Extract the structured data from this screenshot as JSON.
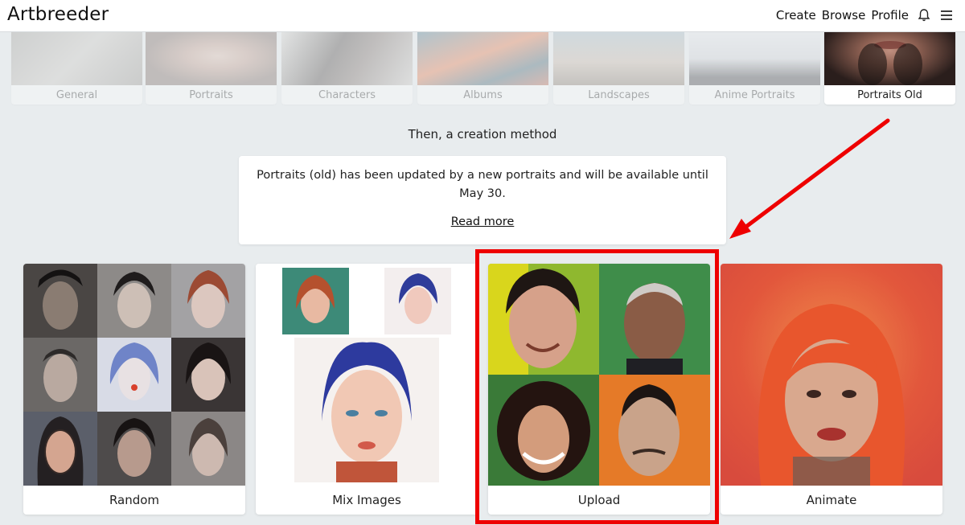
{
  "header": {
    "logo": "Artbreeder",
    "nav": [
      "Create",
      "Browse",
      "Profile"
    ],
    "icons": [
      "bell-icon",
      "menu-icon"
    ]
  },
  "categories": [
    {
      "label": "General",
      "selected": false
    },
    {
      "label": "Portraits",
      "selected": false
    },
    {
      "label": "Characters",
      "selected": false
    },
    {
      "label": "Albums",
      "selected": false
    },
    {
      "label": "Landscapes",
      "selected": false
    },
    {
      "label": "Anime Portraits",
      "selected": false
    },
    {
      "label": "Portraits Old",
      "selected": true
    }
  ],
  "subtitle": "Then, a creation method",
  "notice": {
    "text": "Portraits (old) has been updated by a new portraits and will be available until May 30.",
    "link": "Read more"
  },
  "methods": [
    "Random",
    "Mix Images",
    "Upload",
    "Animate"
  ],
  "colors": {
    "highlight": "#e00000",
    "background": "#e8ecee"
  }
}
